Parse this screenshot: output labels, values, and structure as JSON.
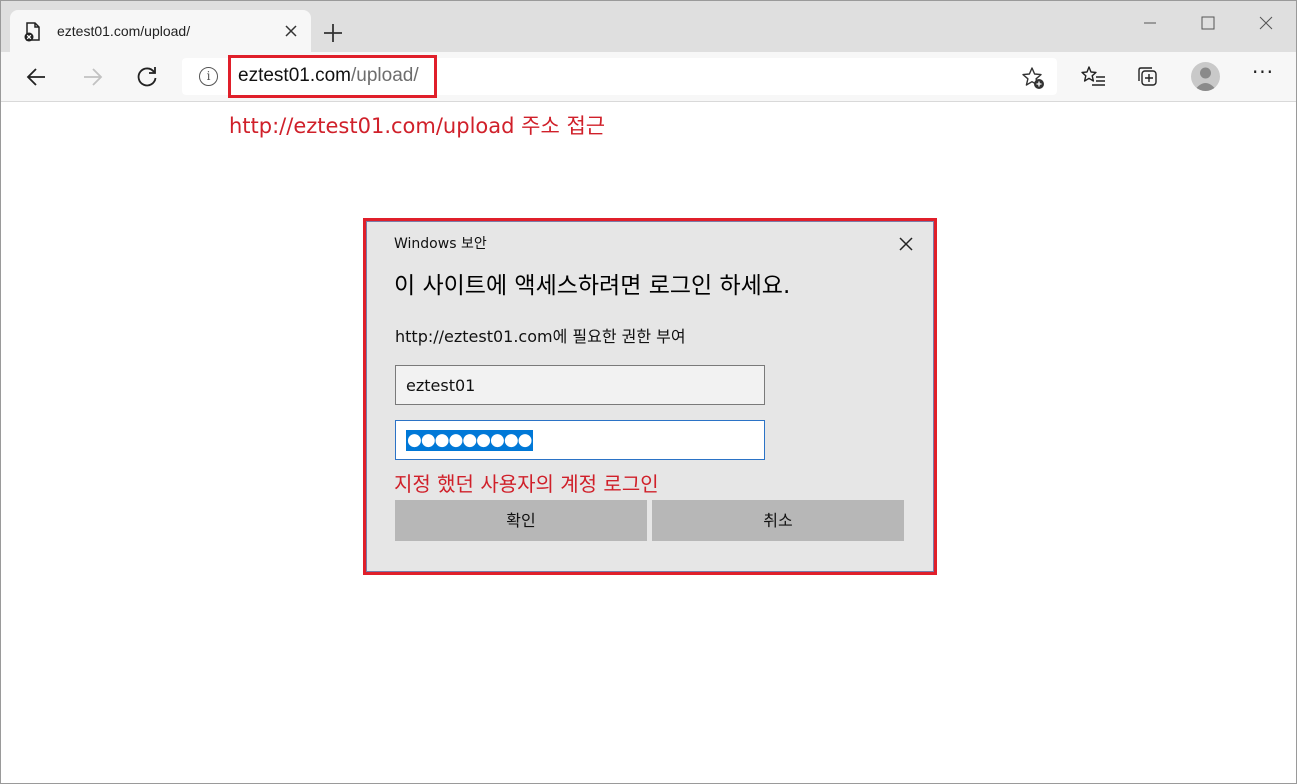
{
  "browser": {
    "tab": {
      "title": "eztest01.com/upload/"
    },
    "address": {
      "host": "eztest01.com",
      "path": "/upload/"
    },
    "new_tab_symbol": "+",
    "menu_symbol": "···"
  },
  "annotations": {
    "url_note": "http://eztest01.com/upload 주소 접근",
    "login_note": "지정 했던 사용자의 계정 로그인"
  },
  "dialog": {
    "caption": "Windows 보안",
    "heading": "이 사이트에 액세스하려면 로그인 하세요.",
    "description": "http://eztest01.com에 필요한 권한 부여",
    "username": "eztest01",
    "password_mask": "●●●●●●●●●",
    "ok_label": "확인",
    "cancel_label": "취소"
  },
  "colors": {
    "annotation": "#e01f2a",
    "selection": "#0078d7",
    "dialog_bg": "#e6e6e6",
    "button_bg": "#b7b7b7"
  }
}
